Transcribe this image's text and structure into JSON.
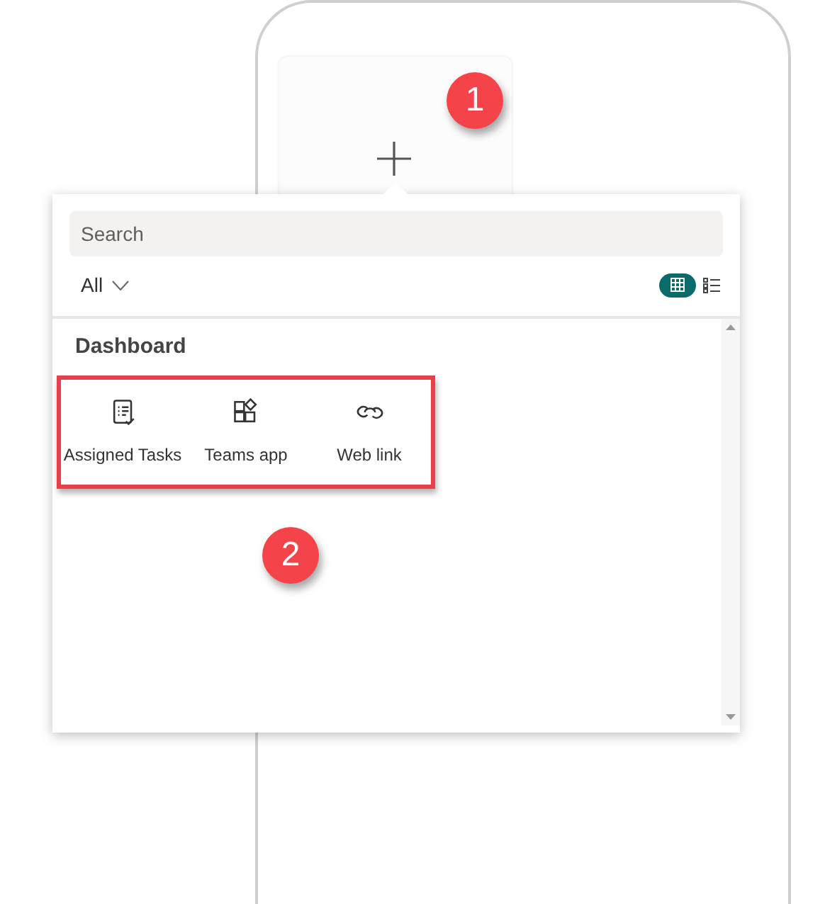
{
  "search": {
    "placeholder": "Search"
  },
  "filter": {
    "label": "All"
  },
  "view_options": [
    {
      "kind": "grid",
      "selected": true
    },
    {
      "kind": "list",
      "selected": false
    }
  ],
  "section": {
    "title": "Dashboard",
    "items": [
      {
        "kind": "tasks",
        "label": "Assigned Tasks"
      },
      {
        "kind": "app",
        "label": "Teams app"
      },
      {
        "kind": "link",
        "label": "Web link"
      }
    ]
  },
  "annotations": [
    {
      "label": "1"
    },
    {
      "label": "2"
    }
  ]
}
